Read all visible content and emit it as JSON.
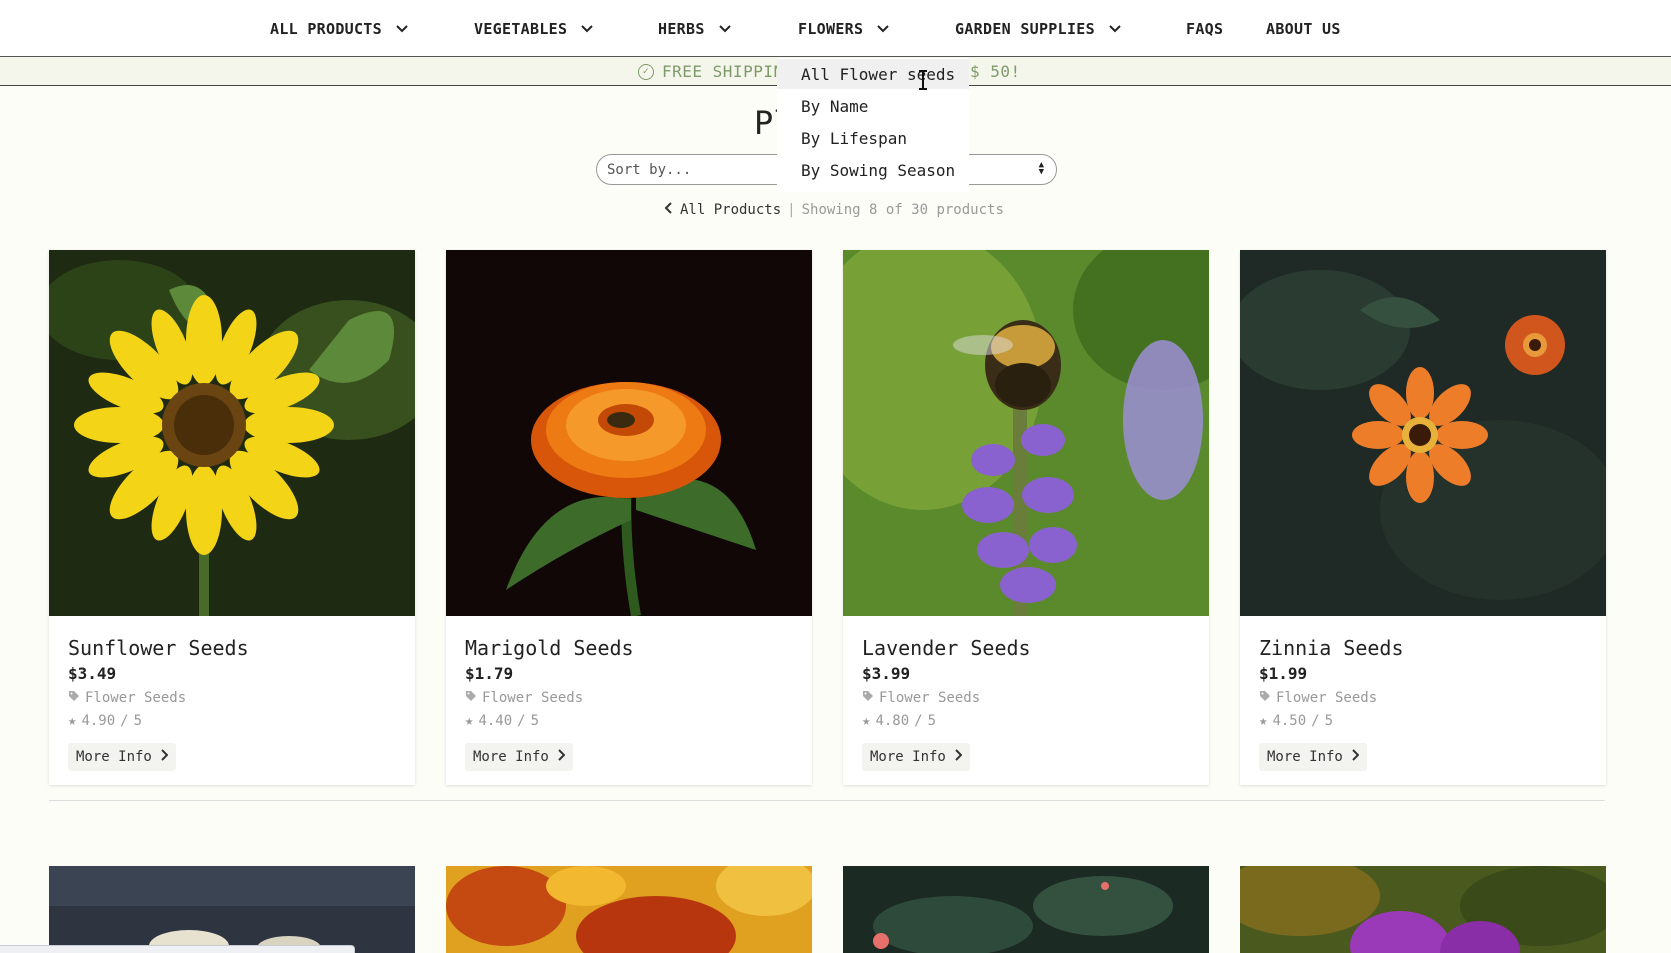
{
  "nav": {
    "items": [
      {
        "label": "ALL PRODUCTS",
        "has_dropdown": true
      },
      {
        "label": "VEGETABLES",
        "has_dropdown": true
      },
      {
        "label": "HERBS",
        "has_dropdown": true
      },
      {
        "label": "FLOWERS",
        "has_dropdown": true
      },
      {
        "label": "GARDEN SUPPLIES",
        "has_dropdown": true
      },
      {
        "label": "FAQS",
        "has_dropdown": false
      },
      {
        "label": "ABOUT US",
        "has_dropdown": false
      }
    ]
  },
  "banner": {
    "text_left": "FREE SHIPPING",
    "text_right": "$ 50!",
    "icon": "check-circle-icon"
  },
  "dropdown": {
    "items": [
      {
        "label": "All Flower seeds",
        "highlighted": true
      },
      {
        "label": "By Name"
      },
      {
        "label": "By Lifespan"
      },
      {
        "label": "By Sowing Season"
      }
    ]
  },
  "page": {
    "title_visible": "Pl",
    "sort_placeholder": "Sort by...",
    "back_label": "All Products",
    "separator": "|",
    "count_text": "Showing 8 of 30 products"
  },
  "products": [
    {
      "name": "Sunflower Seeds",
      "price": "$3.49",
      "category": "Flower Seeds",
      "rating": "4.90",
      "rating_max": "5",
      "button": "More Info",
      "image": "sunflower"
    },
    {
      "name": "Marigold Seeds",
      "price": "$1.79",
      "category": "Flower Seeds",
      "rating": "4.40",
      "rating_max": "5",
      "button": "More Info",
      "image": "marigold"
    },
    {
      "name": "Lavender Seeds",
      "price": "$3.99",
      "category": "Flower Seeds",
      "rating": "4.80",
      "rating_max": "5",
      "button": "More Info",
      "image": "lavender"
    },
    {
      "name": "Zinnia Seeds",
      "price": "$1.99",
      "category": "Flower Seeds",
      "rating": "4.50",
      "rating_max": "5",
      "button": "More Info",
      "image": "zinnia"
    }
  ],
  "colors": {
    "background": "#fdfdf7",
    "banner_text": "#7f9a6a",
    "muted_text": "#999999"
  }
}
